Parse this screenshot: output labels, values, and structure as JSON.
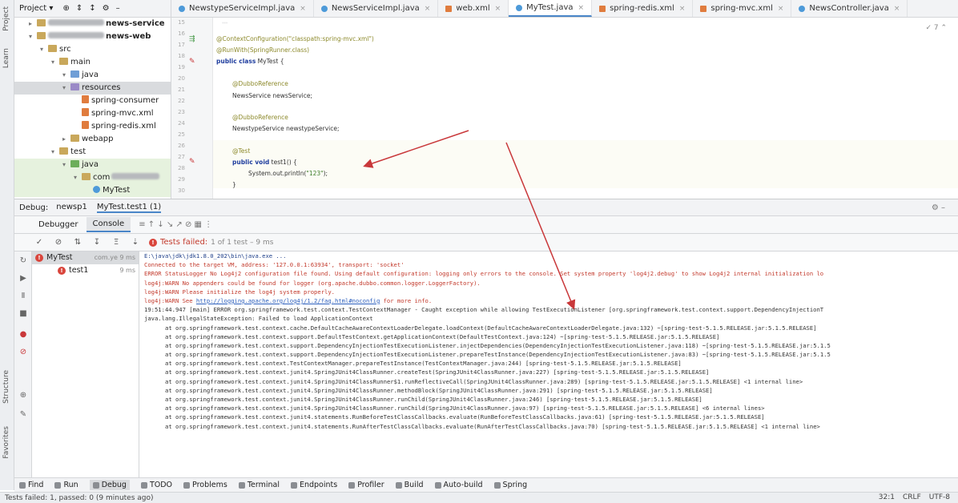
{
  "left_strip": {
    "project_label": "Project",
    "learn_label": "Learn",
    "structure_label": "Structure",
    "favorites_label": "Favorites"
  },
  "project": {
    "header_label": "Project",
    "tree": [
      {
        "label": "news-service",
        "depth": 1,
        "icon": "folder-icon",
        "bold": true
      },
      {
        "label": "news-web",
        "depth": 1,
        "icon": "folder-icon",
        "bold": true
      },
      {
        "label": "src",
        "depth": 2,
        "icon": "folder-icon"
      },
      {
        "label": "main",
        "depth": 3,
        "icon": "folder-icon"
      },
      {
        "label": "java",
        "depth": 4,
        "icon": "folder-blue-icon"
      },
      {
        "label": "resources",
        "depth": 4,
        "icon": "resources-folder-icon",
        "selected": true
      },
      {
        "label": "spring-consumer",
        "depth": 5,
        "icon": "xml-file-icon"
      },
      {
        "label": "spring-mvc.xml",
        "depth": 5,
        "icon": "xml-file-icon"
      },
      {
        "label": "spring-redis.xml",
        "depth": 5,
        "icon": "xml-file-icon"
      },
      {
        "label": "webapp",
        "depth": 4,
        "icon": "folder-icon"
      },
      {
        "label": "test",
        "depth": 3,
        "icon": "folder-icon"
      },
      {
        "label": "java",
        "depth": 4,
        "icon": "folder-green-icon",
        "tint": true
      },
      {
        "label": "com",
        "depth": 5,
        "icon": "folder-icon",
        "tint": true
      },
      {
        "label": "MyTest",
        "depth": 6,
        "icon": "class-icon",
        "tint": true
      }
    ]
  },
  "editor_tabs": [
    {
      "label": "NewstypeServiceImpl.java",
      "icon": "class"
    },
    {
      "label": "NewsServiceImpl.java",
      "icon": "class"
    },
    {
      "label": "web.xml",
      "icon": "xml"
    },
    {
      "label": "MyTest.java",
      "icon": "class",
      "active": true
    },
    {
      "label": "spring-redis.xml",
      "icon": "xml"
    },
    {
      "label": "spring-mvc.xml",
      "icon": "xml"
    },
    {
      "label": "NewsController.java",
      "icon": "class"
    }
  ],
  "editor": {
    "line_numbers": [
      "15",
      "16",
      "17",
      "18",
      "19",
      "20",
      "21",
      "22",
      "23",
      "24",
      "25",
      "26",
      "27",
      "28",
      "29",
      "30"
    ],
    "lines": {
      "l1": "@ContextConfiguration(\"classpath:spring-mvc.xml\")",
      "l2": "@RunWith(SpringRunner.class)",
      "l3_kw": "public class",
      "l3_rest": " MyTest {",
      "l4": "@DubboReference",
      "l5": "NewsService newsService;",
      "l6": "@DubboReference",
      "l7": "NewstypeService newstypeService;",
      "l8": "@Test",
      "l9_kw": "public void",
      "l9_rest": " test1() {",
      "l10_a": "System.out.println(",
      "l10_str": "\"123\"",
      "l10_b": ");",
      "l11": "}"
    }
  },
  "debug": {
    "label": "Debug:",
    "tabs": [
      "newsp1",
      "MyTest.test1 (1)"
    ],
    "sub_tabs": [
      "Debugger",
      "Console"
    ],
    "status_text": "Tests failed:",
    "status_detail": "1 of 1 test – 9 ms",
    "test_tree": [
      {
        "label": "MyTest",
        "duration": "com.ye 9 ms",
        "selected": true
      },
      {
        "label": "test1",
        "duration": "9 ms"
      }
    ]
  },
  "console": {
    "lines": [
      {
        "text": "E:\\java\\jdk\\jdk1.8.0_202\\bin\\java.exe ...",
        "kind": "info"
      },
      {
        "text": "Connected to the target VM, address: '127.0.0.1:63934', transport: 'socket'",
        "kind": "err"
      },
      {
        "text": "ERROR StatusLogger No Log4j2 configuration file found. Using default configuration: logging only errors to the console. Set system property 'log4j2.debug' to show Log4j2 internal initialization lo",
        "kind": "err"
      },
      {
        "text": "log4j:WARN No appenders could be found for logger (org.apache.dubbo.common.logger.LoggerFactory).",
        "kind": "err"
      },
      {
        "text": "log4j:WARN Please initialize the log4j system properly.",
        "kind": "err"
      },
      {
        "pre": "log4j:WARN See ",
        "link": "http://logging.apache.org/log4j/1.2/faq.html#noconfig",
        "post": " for more info.",
        "kind": "err"
      },
      {
        "text": "19:51:44.947 [main] ERROR org.springframework.test.context.TestContextManager - Caught exception while allowing TestExecutionListener [org.springframework.test.context.support.DependencyInjectionT",
        "kind": "plain"
      },
      {
        "text": "java.lang.IllegalStateException: Failed to load ApplicationContext",
        "kind": "plain"
      },
      {
        "text": "at org.springframework.test.context.cache.DefaultCacheAwareContextLoaderDelegate.loadContext(DefaultCacheAwareContextLoaderDelegate.java:132) ~[spring-test-5.1.5.RELEASE.jar:5.1.5.RELEASE]",
        "kind": "stack"
      },
      {
        "text": "at org.springframework.test.context.support.DefaultTestContext.getApplicationContext(DefaultTestContext.java:124) ~[spring-test-5.1.5.RELEASE.jar:5.1.5.RELEASE]",
        "kind": "stack"
      },
      {
        "text": "at org.springframework.test.context.support.DependencyInjectionTestExecutionListener.injectDependencies(DependencyInjectionTestExecutionListener.java:118) ~[spring-test-5.1.5.RELEASE.jar:5.1.5",
        "kind": "stack"
      },
      {
        "text": "at org.springframework.test.context.support.DependencyInjectionTestExecutionListener.prepareTestInstance(DependencyInjectionTestExecutionListener.java:83) ~[spring-test-5.1.5.RELEASE.jar:5.1.5",
        "kind": "stack"
      },
      {
        "text": "at org.springframework.test.context.TestContextManager.prepareTestInstance(TestContextManager.java:244) [spring-test-5.1.5.RELEASE.jar:5.1.5.RELEASE]",
        "kind": "stack"
      },
      {
        "text": "at org.springframework.test.context.junit4.SpringJUnit4ClassRunner.createTest(SpringJUnit4ClassRunner.java:227) [spring-test-5.1.5.RELEASE.jar:5.1.5.RELEASE]",
        "kind": "stack"
      },
      {
        "text": "at org.springframework.test.context.junit4.SpringJUnit4ClassRunner$1.runReflectiveCall(SpringJUnit4ClassRunner.java:289) [spring-test-5.1.5.RELEASE.jar:5.1.5.RELEASE] <1 internal line>",
        "kind": "stack"
      },
      {
        "text": "at org.springframework.test.context.junit4.SpringJUnit4ClassRunner.methodBlock(SpringJUnit4ClassRunner.java:291) [spring-test-5.1.5.RELEASE.jar:5.1.5.RELEASE]",
        "kind": "stack"
      },
      {
        "text": "at org.springframework.test.context.junit4.SpringJUnit4ClassRunner.runChild(SpringJUnit4ClassRunner.java:246) [spring-test-5.1.5.RELEASE.jar:5.1.5.RELEASE]",
        "kind": "stack"
      },
      {
        "text": "at org.springframework.test.context.junit4.SpringJUnit4ClassRunner.runChild(SpringJUnit4ClassRunner.java:97) [spring-test-5.1.5.RELEASE.jar:5.1.5.RELEASE] <6 internal lines>",
        "kind": "stack"
      },
      {
        "text": "at org.springframework.test.context.junit4.statements.RunBeforeTestClassCallbacks.evaluate(RunBeforeTestClassCallbacks.java:61) [spring-test-5.1.5.RELEASE.jar:5.1.5.RELEASE]",
        "kind": "stack"
      },
      {
        "text": "at org.springframework.test.context.junit4.statements.RunAfterTestClassCallbacks.evaluate(RunAfterTestClassCallbacks.java:70) [spring-test-5.1.5.RELEASE.jar:5.1.5.RELEASE] <1 internal line>",
        "kind": "stack"
      }
    ]
  },
  "bottom_bar": [
    {
      "label": "Find",
      "icon": "search-icon"
    },
    {
      "label": "Run",
      "icon": "run-icon"
    },
    {
      "label": "Debug",
      "icon": "bug-icon",
      "active": true
    },
    {
      "label": "TODO",
      "icon": "list-icon"
    },
    {
      "label": "Problems",
      "icon": "warning-icon"
    },
    {
      "label": "Terminal",
      "icon": "terminal-icon"
    },
    {
      "label": "Endpoints",
      "icon": "endpoints-icon"
    },
    {
      "label": "Profiler",
      "icon": "profiler-icon"
    },
    {
      "label": "Build",
      "icon": "hammer-icon"
    },
    {
      "label": "Auto-build",
      "icon": "auto-build-icon"
    },
    {
      "label": "Spring",
      "icon": "spring-icon"
    }
  ],
  "status": {
    "message": "Tests failed: 1, passed: 0 (9 minutes ago)",
    "position": "32:1",
    "line_sep": "CRLF",
    "encoding": "UTF-8"
  },
  "colors": {
    "accent": "#4a86c8",
    "error": "#c33a2c",
    "arrow": "#c9383a"
  }
}
